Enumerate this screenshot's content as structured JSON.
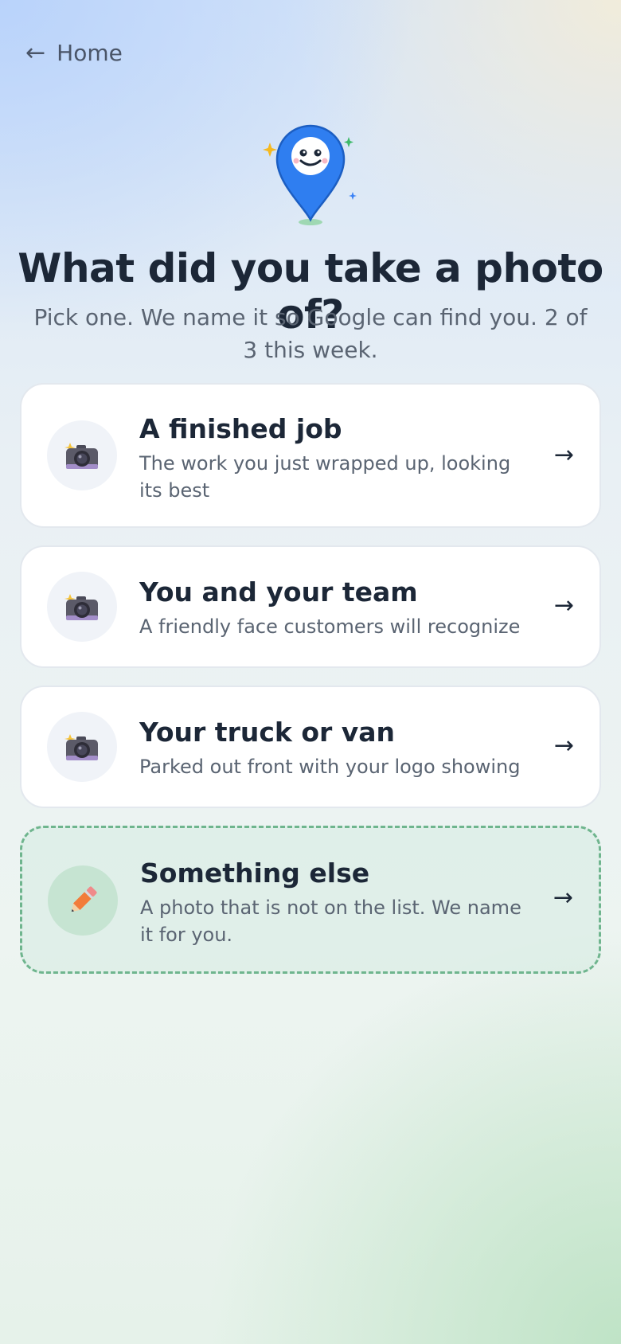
{
  "nav": {
    "back_arrow": "←",
    "back_label": "Home"
  },
  "header": {
    "title": "What did you take a photo of?",
    "subtitle": "Pick one. We name it so Google can find you. 2 of 3 this week."
  },
  "options": [
    {
      "title": "A finished job",
      "description": "The work you just wrapped up, looking its best",
      "icon": "camera-icon",
      "arrow": "→"
    },
    {
      "title": "You and your team",
      "description": "A friendly face customers will recognize",
      "icon": "camera-icon",
      "arrow": "→"
    },
    {
      "title": "Your truck or van",
      "description": "Parked out front with your logo showing",
      "icon": "camera-icon",
      "arrow": "→"
    },
    {
      "title": "Something else",
      "description": "A photo that is not on the list. We name it for you.",
      "icon": "pencil-icon",
      "arrow": "→"
    }
  ],
  "colors": {
    "accent_blue": "#2f7ef0",
    "dashed_border": "#6fb58e",
    "text_dark": "#1c2737"
  }
}
